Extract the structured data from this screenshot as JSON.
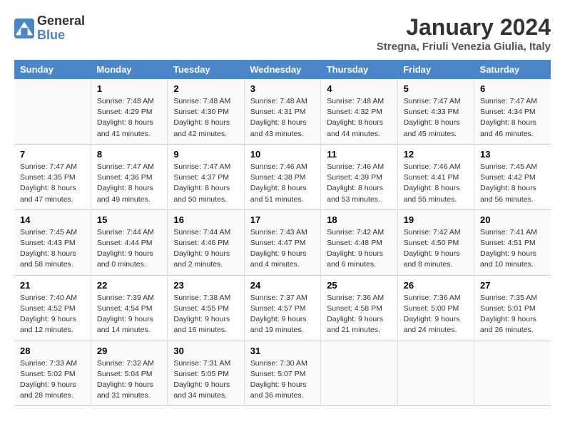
{
  "header": {
    "logo_line1": "General",
    "logo_line2": "Blue",
    "month": "January 2024",
    "location": "Stregna, Friuli Venezia Giulia, Italy"
  },
  "weekdays": [
    "Sunday",
    "Monday",
    "Tuesday",
    "Wednesday",
    "Thursday",
    "Friday",
    "Saturday"
  ],
  "weeks": [
    [
      {
        "day": "",
        "info": ""
      },
      {
        "day": "1",
        "info": "Sunrise: 7:48 AM\nSunset: 4:29 PM\nDaylight: 8 hours\nand 41 minutes."
      },
      {
        "day": "2",
        "info": "Sunrise: 7:48 AM\nSunset: 4:30 PM\nDaylight: 8 hours\nand 42 minutes."
      },
      {
        "day": "3",
        "info": "Sunrise: 7:48 AM\nSunset: 4:31 PM\nDaylight: 8 hours\nand 43 minutes."
      },
      {
        "day": "4",
        "info": "Sunrise: 7:48 AM\nSunset: 4:32 PM\nDaylight: 8 hours\nand 44 minutes."
      },
      {
        "day": "5",
        "info": "Sunrise: 7:47 AM\nSunset: 4:33 PM\nDaylight: 8 hours\nand 45 minutes."
      },
      {
        "day": "6",
        "info": "Sunrise: 7:47 AM\nSunset: 4:34 PM\nDaylight: 8 hours\nand 46 minutes."
      }
    ],
    [
      {
        "day": "7",
        "info": "Sunrise: 7:47 AM\nSunset: 4:35 PM\nDaylight: 8 hours\nand 47 minutes."
      },
      {
        "day": "8",
        "info": "Sunrise: 7:47 AM\nSunset: 4:36 PM\nDaylight: 8 hours\nand 49 minutes."
      },
      {
        "day": "9",
        "info": "Sunrise: 7:47 AM\nSunset: 4:37 PM\nDaylight: 8 hours\nand 50 minutes."
      },
      {
        "day": "10",
        "info": "Sunrise: 7:46 AM\nSunset: 4:38 PM\nDaylight: 8 hours\nand 51 minutes."
      },
      {
        "day": "11",
        "info": "Sunrise: 7:46 AM\nSunset: 4:39 PM\nDaylight: 8 hours\nand 53 minutes."
      },
      {
        "day": "12",
        "info": "Sunrise: 7:46 AM\nSunset: 4:41 PM\nDaylight: 8 hours\nand 55 minutes."
      },
      {
        "day": "13",
        "info": "Sunrise: 7:45 AM\nSunset: 4:42 PM\nDaylight: 8 hours\nand 56 minutes."
      }
    ],
    [
      {
        "day": "14",
        "info": "Sunrise: 7:45 AM\nSunset: 4:43 PM\nDaylight: 8 hours\nand 58 minutes."
      },
      {
        "day": "15",
        "info": "Sunrise: 7:44 AM\nSunset: 4:44 PM\nDaylight: 9 hours\nand 0 minutes."
      },
      {
        "day": "16",
        "info": "Sunrise: 7:44 AM\nSunset: 4:46 PM\nDaylight: 9 hours\nand 2 minutes."
      },
      {
        "day": "17",
        "info": "Sunrise: 7:43 AM\nSunset: 4:47 PM\nDaylight: 9 hours\nand 4 minutes."
      },
      {
        "day": "18",
        "info": "Sunrise: 7:42 AM\nSunset: 4:48 PM\nDaylight: 9 hours\nand 6 minutes."
      },
      {
        "day": "19",
        "info": "Sunrise: 7:42 AM\nSunset: 4:50 PM\nDaylight: 9 hours\nand 8 minutes."
      },
      {
        "day": "20",
        "info": "Sunrise: 7:41 AM\nSunset: 4:51 PM\nDaylight: 9 hours\nand 10 minutes."
      }
    ],
    [
      {
        "day": "21",
        "info": "Sunrise: 7:40 AM\nSunset: 4:52 PM\nDaylight: 9 hours\nand 12 minutes."
      },
      {
        "day": "22",
        "info": "Sunrise: 7:39 AM\nSunset: 4:54 PM\nDaylight: 9 hours\nand 14 minutes."
      },
      {
        "day": "23",
        "info": "Sunrise: 7:38 AM\nSunset: 4:55 PM\nDaylight: 9 hours\nand 16 minutes."
      },
      {
        "day": "24",
        "info": "Sunrise: 7:37 AM\nSunset: 4:57 PM\nDaylight: 9 hours\nand 19 minutes."
      },
      {
        "day": "25",
        "info": "Sunrise: 7:36 AM\nSunset: 4:58 PM\nDaylight: 9 hours\nand 21 minutes."
      },
      {
        "day": "26",
        "info": "Sunrise: 7:36 AM\nSunset: 5:00 PM\nDaylight: 9 hours\nand 24 minutes."
      },
      {
        "day": "27",
        "info": "Sunrise: 7:35 AM\nSunset: 5:01 PM\nDaylight: 9 hours\nand 26 minutes."
      }
    ],
    [
      {
        "day": "28",
        "info": "Sunrise: 7:33 AM\nSunset: 5:02 PM\nDaylight: 9 hours\nand 28 minutes."
      },
      {
        "day": "29",
        "info": "Sunrise: 7:32 AM\nSunset: 5:04 PM\nDaylight: 9 hours\nand 31 minutes."
      },
      {
        "day": "30",
        "info": "Sunrise: 7:31 AM\nSunset: 5:05 PM\nDaylight: 9 hours\nand 34 minutes."
      },
      {
        "day": "31",
        "info": "Sunrise: 7:30 AM\nSunset: 5:07 PM\nDaylight: 9 hours\nand 36 minutes."
      },
      {
        "day": "",
        "info": ""
      },
      {
        "day": "",
        "info": ""
      },
      {
        "day": "",
        "info": ""
      }
    ]
  ]
}
